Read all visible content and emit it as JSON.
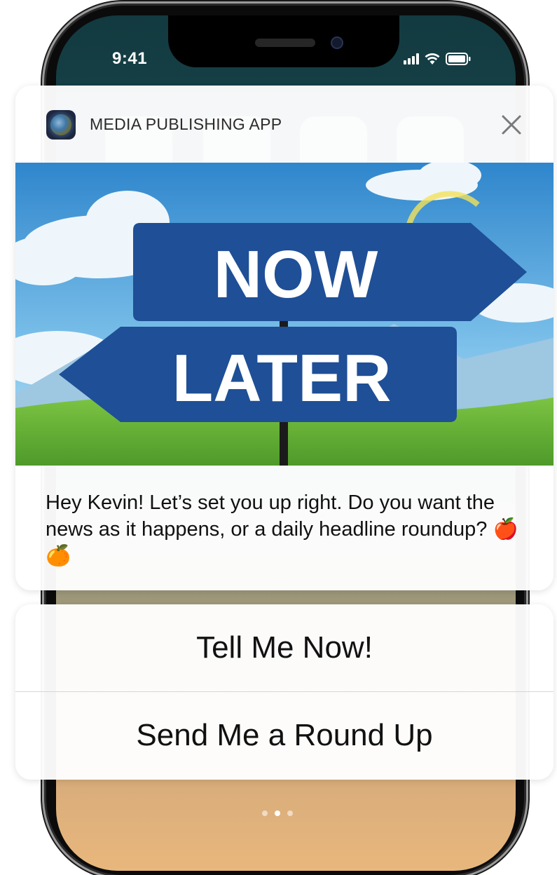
{
  "status_bar": {
    "time": "9:41"
  },
  "notification": {
    "app_name": "MEDIA PUBLISHING APP",
    "image_sign_top": "NOW",
    "image_sign_bottom": "LATER",
    "message": "Hey Kevin! Let’s set you up right. Do you want the news as it happens, or a daily headline roundup? 🍎 🍊"
  },
  "actions": [
    {
      "label": "Tell Me Now!"
    },
    {
      "label": "Send Me a Round Up"
    }
  ],
  "icons": [
    "signal-icon",
    "wifi-icon",
    "battery-icon",
    "app-icon",
    "close-icon"
  ],
  "colors": {
    "sign_blue": "#1f4f96",
    "sky": "#5fa6dc",
    "grass": "#6fb53a"
  }
}
